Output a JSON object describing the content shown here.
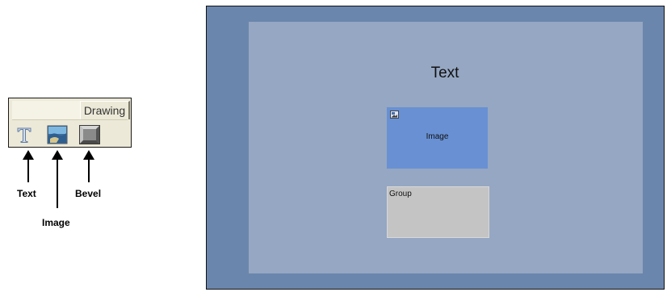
{
  "toolbar": {
    "tab_label": "Drawing",
    "tools": [
      {
        "icon": "text-tool-icon",
        "callout": "Text"
      },
      {
        "icon": "image-tool-icon",
        "callout": "Image"
      },
      {
        "icon": "bevel-tool-icon",
        "callout": "Bevel"
      }
    ]
  },
  "canvas": {
    "text_element": "Text",
    "image_element": {
      "label": "Image",
      "icon": "image-placeholder-icon"
    },
    "group_element": {
      "label": "Group"
    }
  },
  "colors": {
    "canvas_bg": "#6b86ad",
    "panel_bg": "#95a7c2",
    "image_bg": "#6890d3",
    "group_bg": "#c4c4c4",
    "toolbar_bg": "#ece9d8"
  }
}
